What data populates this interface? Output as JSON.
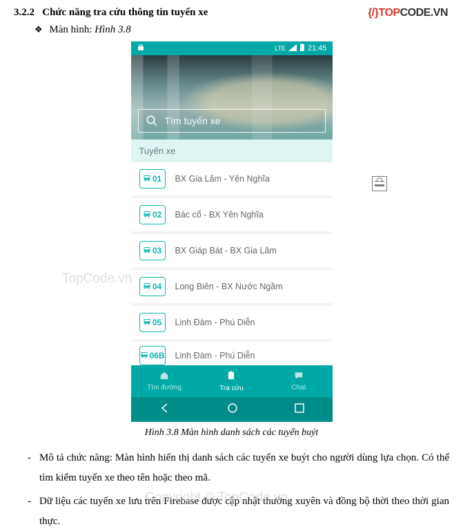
{
  "header": {
    "section_num": "3.2.2",
    "section_title": "Chức năng tra cứu thông tin tuyến xe",
    "subline_prefix": "Màn hình:",
    "subline_fig": "Hình 3.8"
  },
  "logo": {
    "bracket": "{/}",
    "top": "TOP",
    "code": "CODE",
    "vn": ".VN"
  },
  "phone": {
    "status": {
      "lte": "LTE",
      "time": "21:45"
    },
    "search_placeholder": "Tìm tuyến xe",
    "section_label": "Tuyến xe",
    "routes": [
      {
        "num": "01",
        "name": "BX Gia Lâm - Yên Nghĩa"
      },
      {
        "num": "02",
        "name": "Bác cổ - BX Yên Nghĩa"
      },
      {
        "num": "03",
        "name": "BX Giáp Bát - BX Gia Lâm"
      },
      {
        "num": "04",
        "name": "Long Biên - BX Nước Ngầm"
      },
      {
        "num": "05",
        "name": "Linh Đàm - Phú Diễn"
      },
      {
        "num": "06B",
        "name": "Linh Đàm - Phú Diễn"
      }
    ],
    "tabs": [
      {
        "label": "Tìm đường",
        "icon": "home"
      },
      {
        "label": "Tra cứu",
        "icon": "clipboard"
      },
      {
        "label": "Chat",
        "icon": "chat"
      }
    ]
  },
  "caption": "Hình 3.8 Màn hình danh sách các tuyến buýt",
  "descriptions": [
    "Mô tả chức năng: Màn hình hiển thị danh sách các tuyến xe buýt cho người dùng lựa chọn. Có thể tìm kiếm tuyến xe theo tên hoặc theo mã.",
    "Dữ liệu các tuyến xe lưu trên Firebase được cập nhật thường xuyên và  đồng bộ thời theo thời gian thực."
  ],
  "watermark1": "TopCode.vn",
  "watermark2": "Copyright © TopCode.vn"
}
